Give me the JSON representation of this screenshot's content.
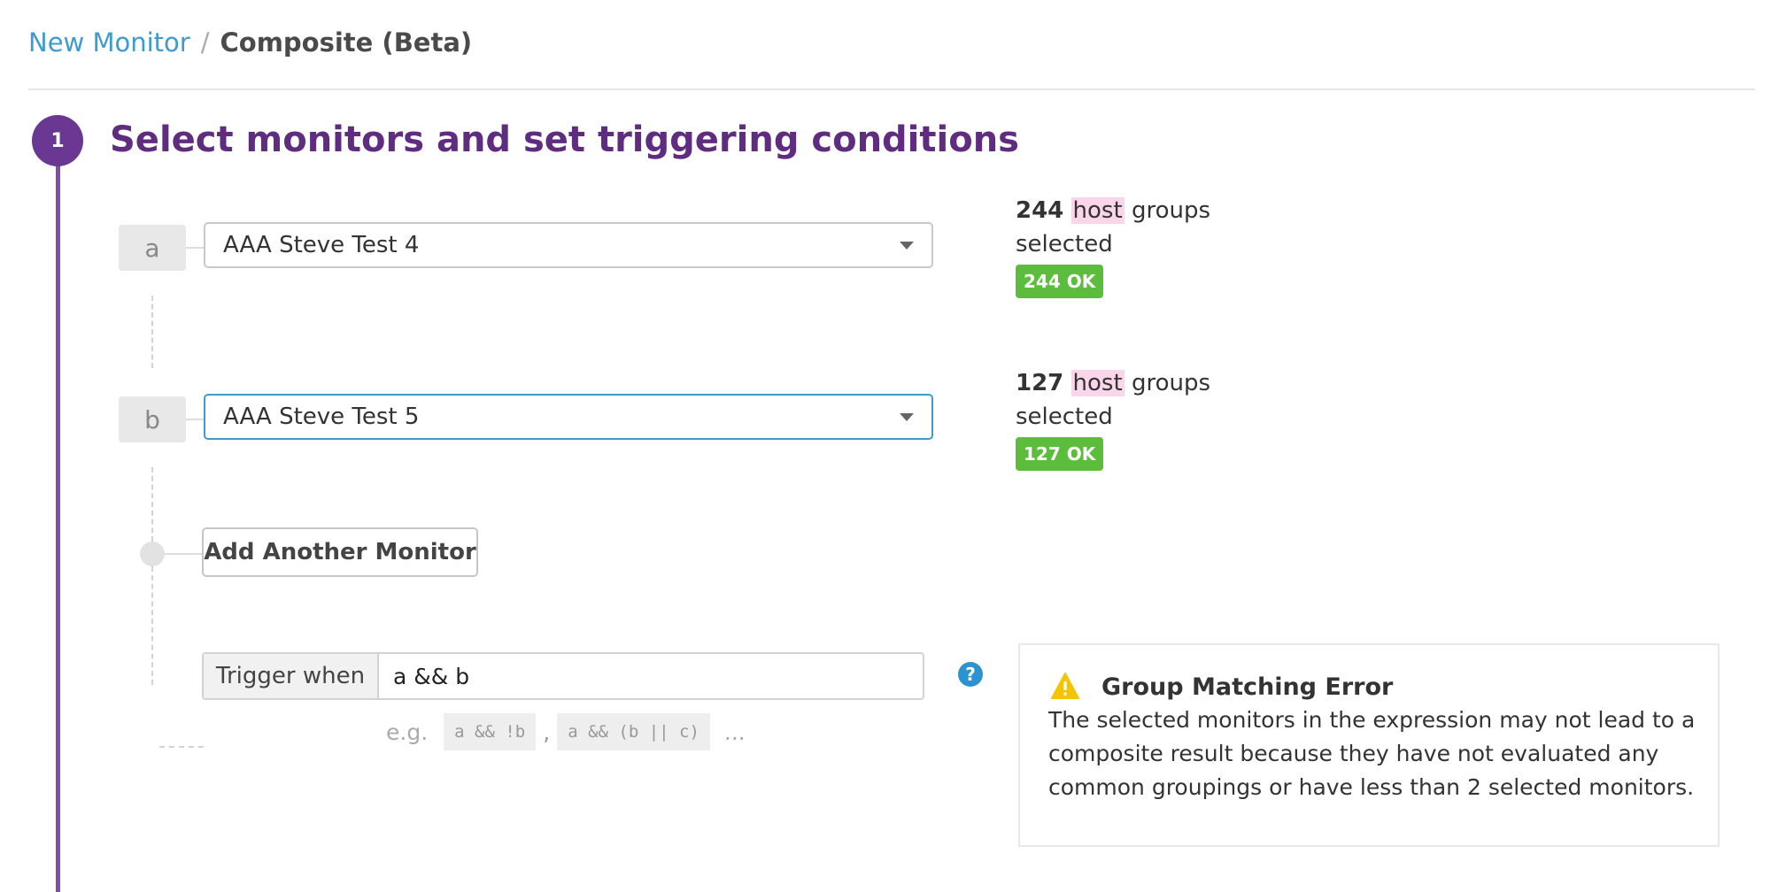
{
  "breadcrumb": {
    "parent": "New Monitor",
    "separator": "/",
    "current": "Composite (Beta)"
  },
  "step": {
    "number": "1",
    "title": "Select monitors and set triggering conditions"
  },
  "monitors": [
    {
      "letter": "a",
      "name": "AAA Steve Test 4",
      "count": "244",
      "host_word": "host",
      "groups_word": "groups",
      "selected_word": "selected",
      "badge": "244 OK"
    },
    {
      "letter": "b",
      "name": "AAA Steve Test 5",
      "count": "127",
      "host_word": "host",
      "groups_word": "groups",
      "selected_word": "selected",
      "badge": "127 OK"
    }
  ],
  "add_button": {
    "label": "Add Another Monitor"
  },
  "trigger": {
    "label": "Trigger when",
    "value": "a && b",
    "help": "?",
    "example_prefix": "e.g.",
    "examples": [
      "a && !b",
      "a && (b || c)"
    ],
    "example_comma": ",",
    "example_more": "..."
  },
  "error": {
    "title": "Group Matching Error",
    "message": "The selected monitors in the expression may not lead to a composite result because they have not evaluated any common groupings or have less than 2 selected monitors."
  },
  "colors": {
    "accent_purple": "#5f2c80",
    "link_blue": "#3d9bd0",
    "ok_green": "#5bbd3b",
    "warning_yellow": "#f5c400",
    "highlight_pink": "#fbd6ea"
  }
}
